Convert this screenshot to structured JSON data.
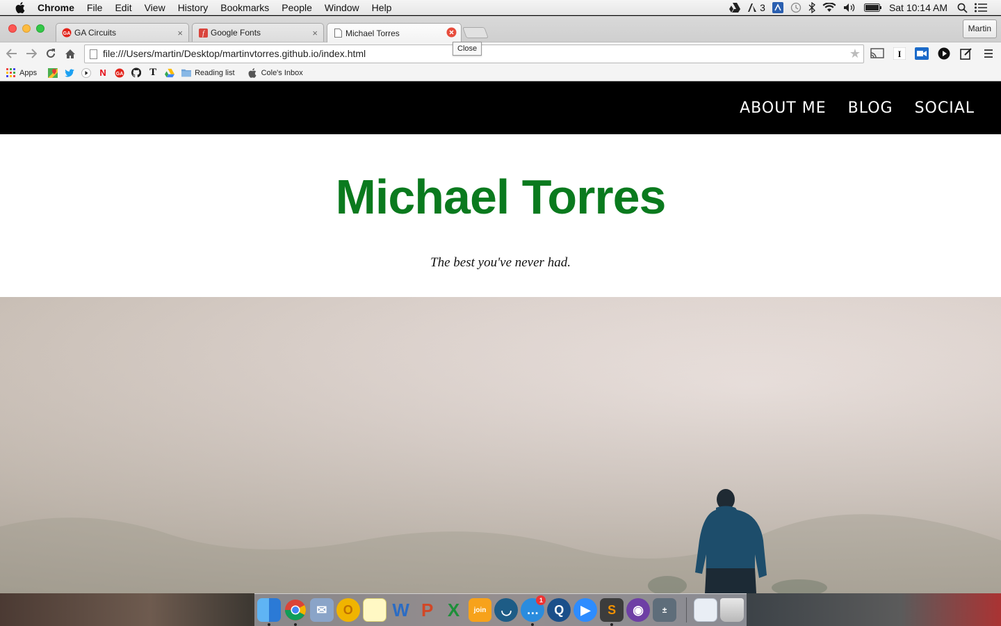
{
  "menubar": {
    "app": "Chrome",
    "items": [
      "File",
      "Edit",
      "View",
      "History",
      "Bookmarks",
      "People",
      "Window",
      "Help"
    ],
    "status": {
      "adobe_count": "3",
      "clock": "Sat 10:14 AM"
    }
  },
  "tabs": [
    {
      "title": "GA Circuits",
      "close": "×",
      "favicon": "ga-circuits-icon"
    },
    {
      "title": "Google Fonts",
      "close": "×",
      "favicon": "google-fonts-icon"
    },
    {
      "title": "Michael Torres",
      "close": "×",
      "favicon": "page-icon"
    }
  ],
  "tooltip": "Close",
  "profile": "Martin",
  "url": "file:///Users/martin/Desktop/martinvtorres.github.io/index.html",
  "bookmarks": [
    {
      "label": "Apps",
      "icon": "apps-grid-icon"
    },
    {
      "label": "",
      "icon": "google-maps-icon"
    },
    {
      "label": "",
      "icon": "twitter-icon"
    },
    {
      "label": "",
      "icon": "youtube-icon"
    },
    {
      "label": "",
      "icon": "netflix-icon"
    },
    {
      "label": "",
      "icon": "ga-icon"
    },
    {
      "label": "",
      "icon": "github-icon"
    },
    {
      "label": "",
      "icon": "nytimes-icon"
    },
    {
      "label": "",
      "icon": "google-drive-icon"
    },
    {
      "label": "Reading list",
      "icon": "folder-icon"
    },
    {
      "label": "Cole's Inbox",
      "icon": "apple-icon"
    }
  ],
  "site": {
    "nav": [
      "ABOUT ME",
      "BLOG",
      "SOCIAL"
    ],
    "title": "Michael Torres",
    "tagline": "The best you've never had."
  },
  "dock_badge": "1",
  "colors": {
    "title_green": "#0a7a1e",
    "nav_bg": "#000000",
    "close_red": "#e74c3c"
  }
}
